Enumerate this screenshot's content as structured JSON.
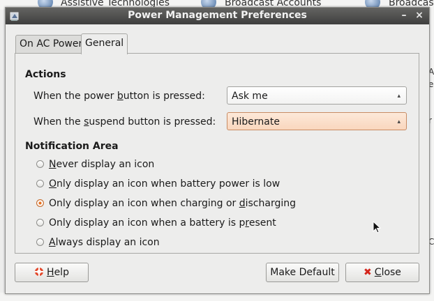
{
  "background": {
    "items": [
      "Assistive Technologies",
      "Broadcast Accounts",
      "Broadcast"
    ],
    "right_chars": [
      "A",
      "e",
      "r",
      "C"
    ]
  },
  "window": {
    "title": "Power Management Preferences",
    "minimize_glyph": "–",
    "close_glyph": "×"
  },
  "tabs": [
    {
      "label": "On AC Power",
      "active": false
    },
    {
      "label": "General",
      "active": true
    }
  ],
  "actions": {
    "title": "Actions",
    "power_button": {
      "label_pre": "When the power ",
      "label_key": "b",
      "label_post": "utton is pressed:",
      "value": "Ask me"
    },
    "suspend_button": {
      "label_pre": "When the ",
      "label_key": "s",
      "label_post": "uspend button is pressed:",
      "value": "Hibernate"
    }
  },
  "notification": {
    "title": "Notification Area",
    "options": [
      {
        "pre": "",
        "key": "N",
        "post": "ever display an icon",
        "checked": false
      },
      {
        "pre": "",
        "key": "O",
        "post": "nly display an icon when battery power is low",
        "checked": false
      },
      {
        "pre": "Only display an icon when charging or ",
        "key": "d",
        "post": "ischarging",
        "checked": true
      },
      {
        "pre": "Only display an icon when a battery is p",
        "key": "r",
        "post": "esent",
        "checked": false
      },
      {
        "pre": "",
        "key": "A",
        "post": "lways display an icon",
        "checked": false
      }
    ]
  },
  "buttons": {
    "help": {
      "pre": "",
      "key": "H",
      "post": "elp"
    },
    "make_default": "Make Default",
    "close": {
      "pre": "",
      "key": "C",
      "post": "lose"
    }
  },
  "colors": {
    "accent": "#e66f1c",
    "focus_combo": "#f9d6bd",
    "titlebar": "#4a4a49"
  }
}
